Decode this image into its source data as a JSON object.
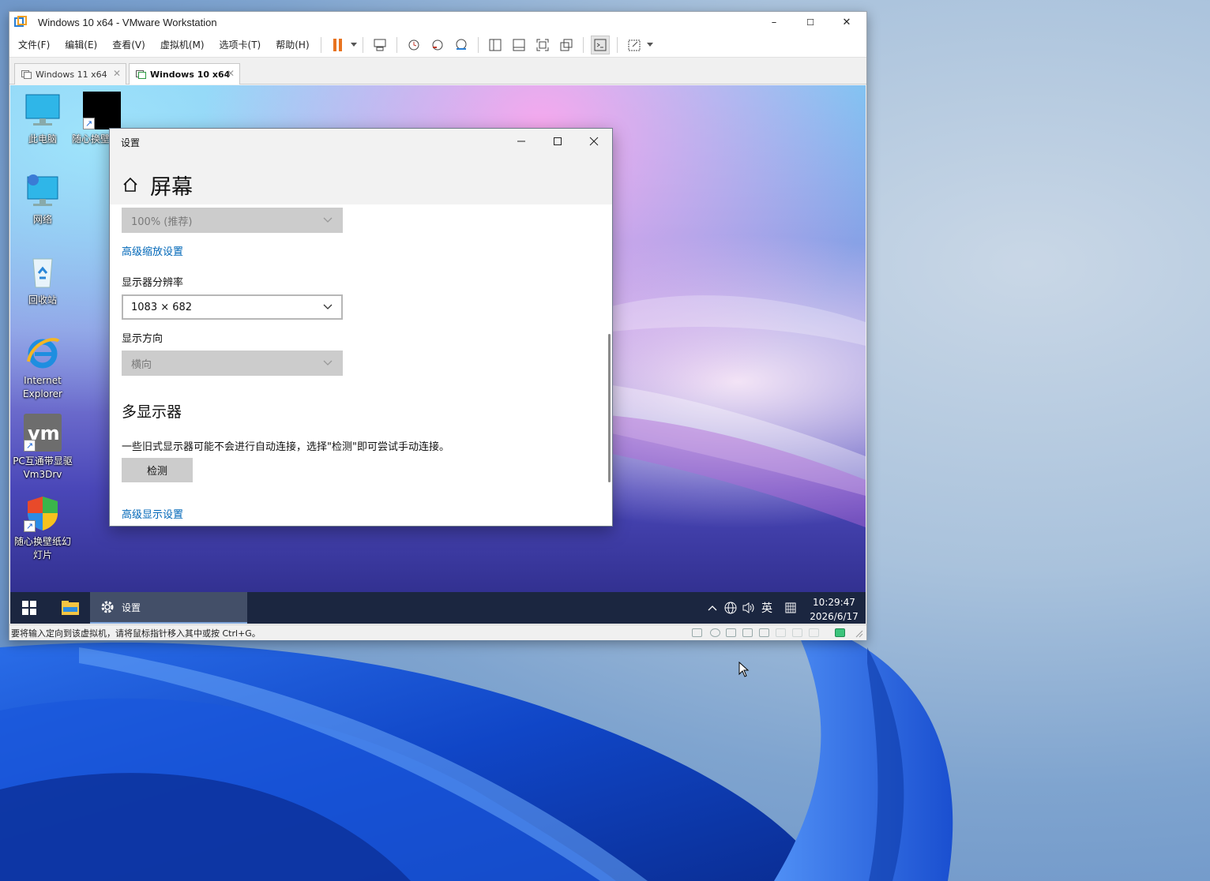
{
  "vmware": {
    "title": "Windows 10 x64 - VMware Workstation",
    "window_controls": {
      "minimize": "–",
      "maximize": "☐",
      "close": "✕"
    },
    "menu": [
      "文件(F)",
      "编辑(E)",
      "查看(V)",
      "虚拟机(M)",
      "选项卡(T)",
      "帮助(H)"
    ],
    "tabs": [
      {
        "label": "Windows 11 x64",
        "close": "✕"
      },
      {
        "label": "Windows 10 x64",
        "close": "✕"
      }
    ],
    "status_text": "要将输入定向到该虚拟机，请将鼠标指针移入其中或按 Ctrl+G。"
  },
  "guest": {
    "desktop_icons": [
      {
        "label": "此电脑",
        "icon": "this-pc-icon"
      },
      {
        "label": "随心换壁纸幻灯片",
        "icon": "black-shortcut-icon"
      },
      {
        "label": "网络",
        "icon": "network-icon"
      },
      {
        "label": "回收站",
        "icon": "recycle-bin-icon"
      },
      {
        "label": "Internet Explorer",
        "icon": "ie-icon"
      },
      {
        "label": "PC互通带显驱Vm3Drv",
        "icon": "vmware-icon"
      },
      {
        "label": "随心换壁纸幻灯片",
        "icon": "shield-icon"
      }
    ],
    "settings": {
      "window_title": "设置",
      "heading": "屏幕",
      "scale_value": "100% (推荐)",
      "advanced_scale_link": "高级缩放设置",
      "resolution_label": "显示器分辨率",
      "resolution_value": "1083 × 682",
      "orientation_label": "显示方向",
      "orientation_value": "横向",
      "multi_heading": "多显示器",
      "multi_desc": "一些旧式显示器可能不会进行自动连接，选择\"检测\"即可尝试手动连接。",
      "detect_button": "检测",
      "advanced_display_link": "高级显示设置"
    },
    "taskbar": {
      "active_app": "设置",
      "ime": "英",
      "time": "10:29:47",
      "date": "2026/6/17"
    }
  },
  "colors": {
    "link": "#0067b8",
    "pause_orange": "#e8731f",
    "taskbar": "#1b2640"
  }
}
